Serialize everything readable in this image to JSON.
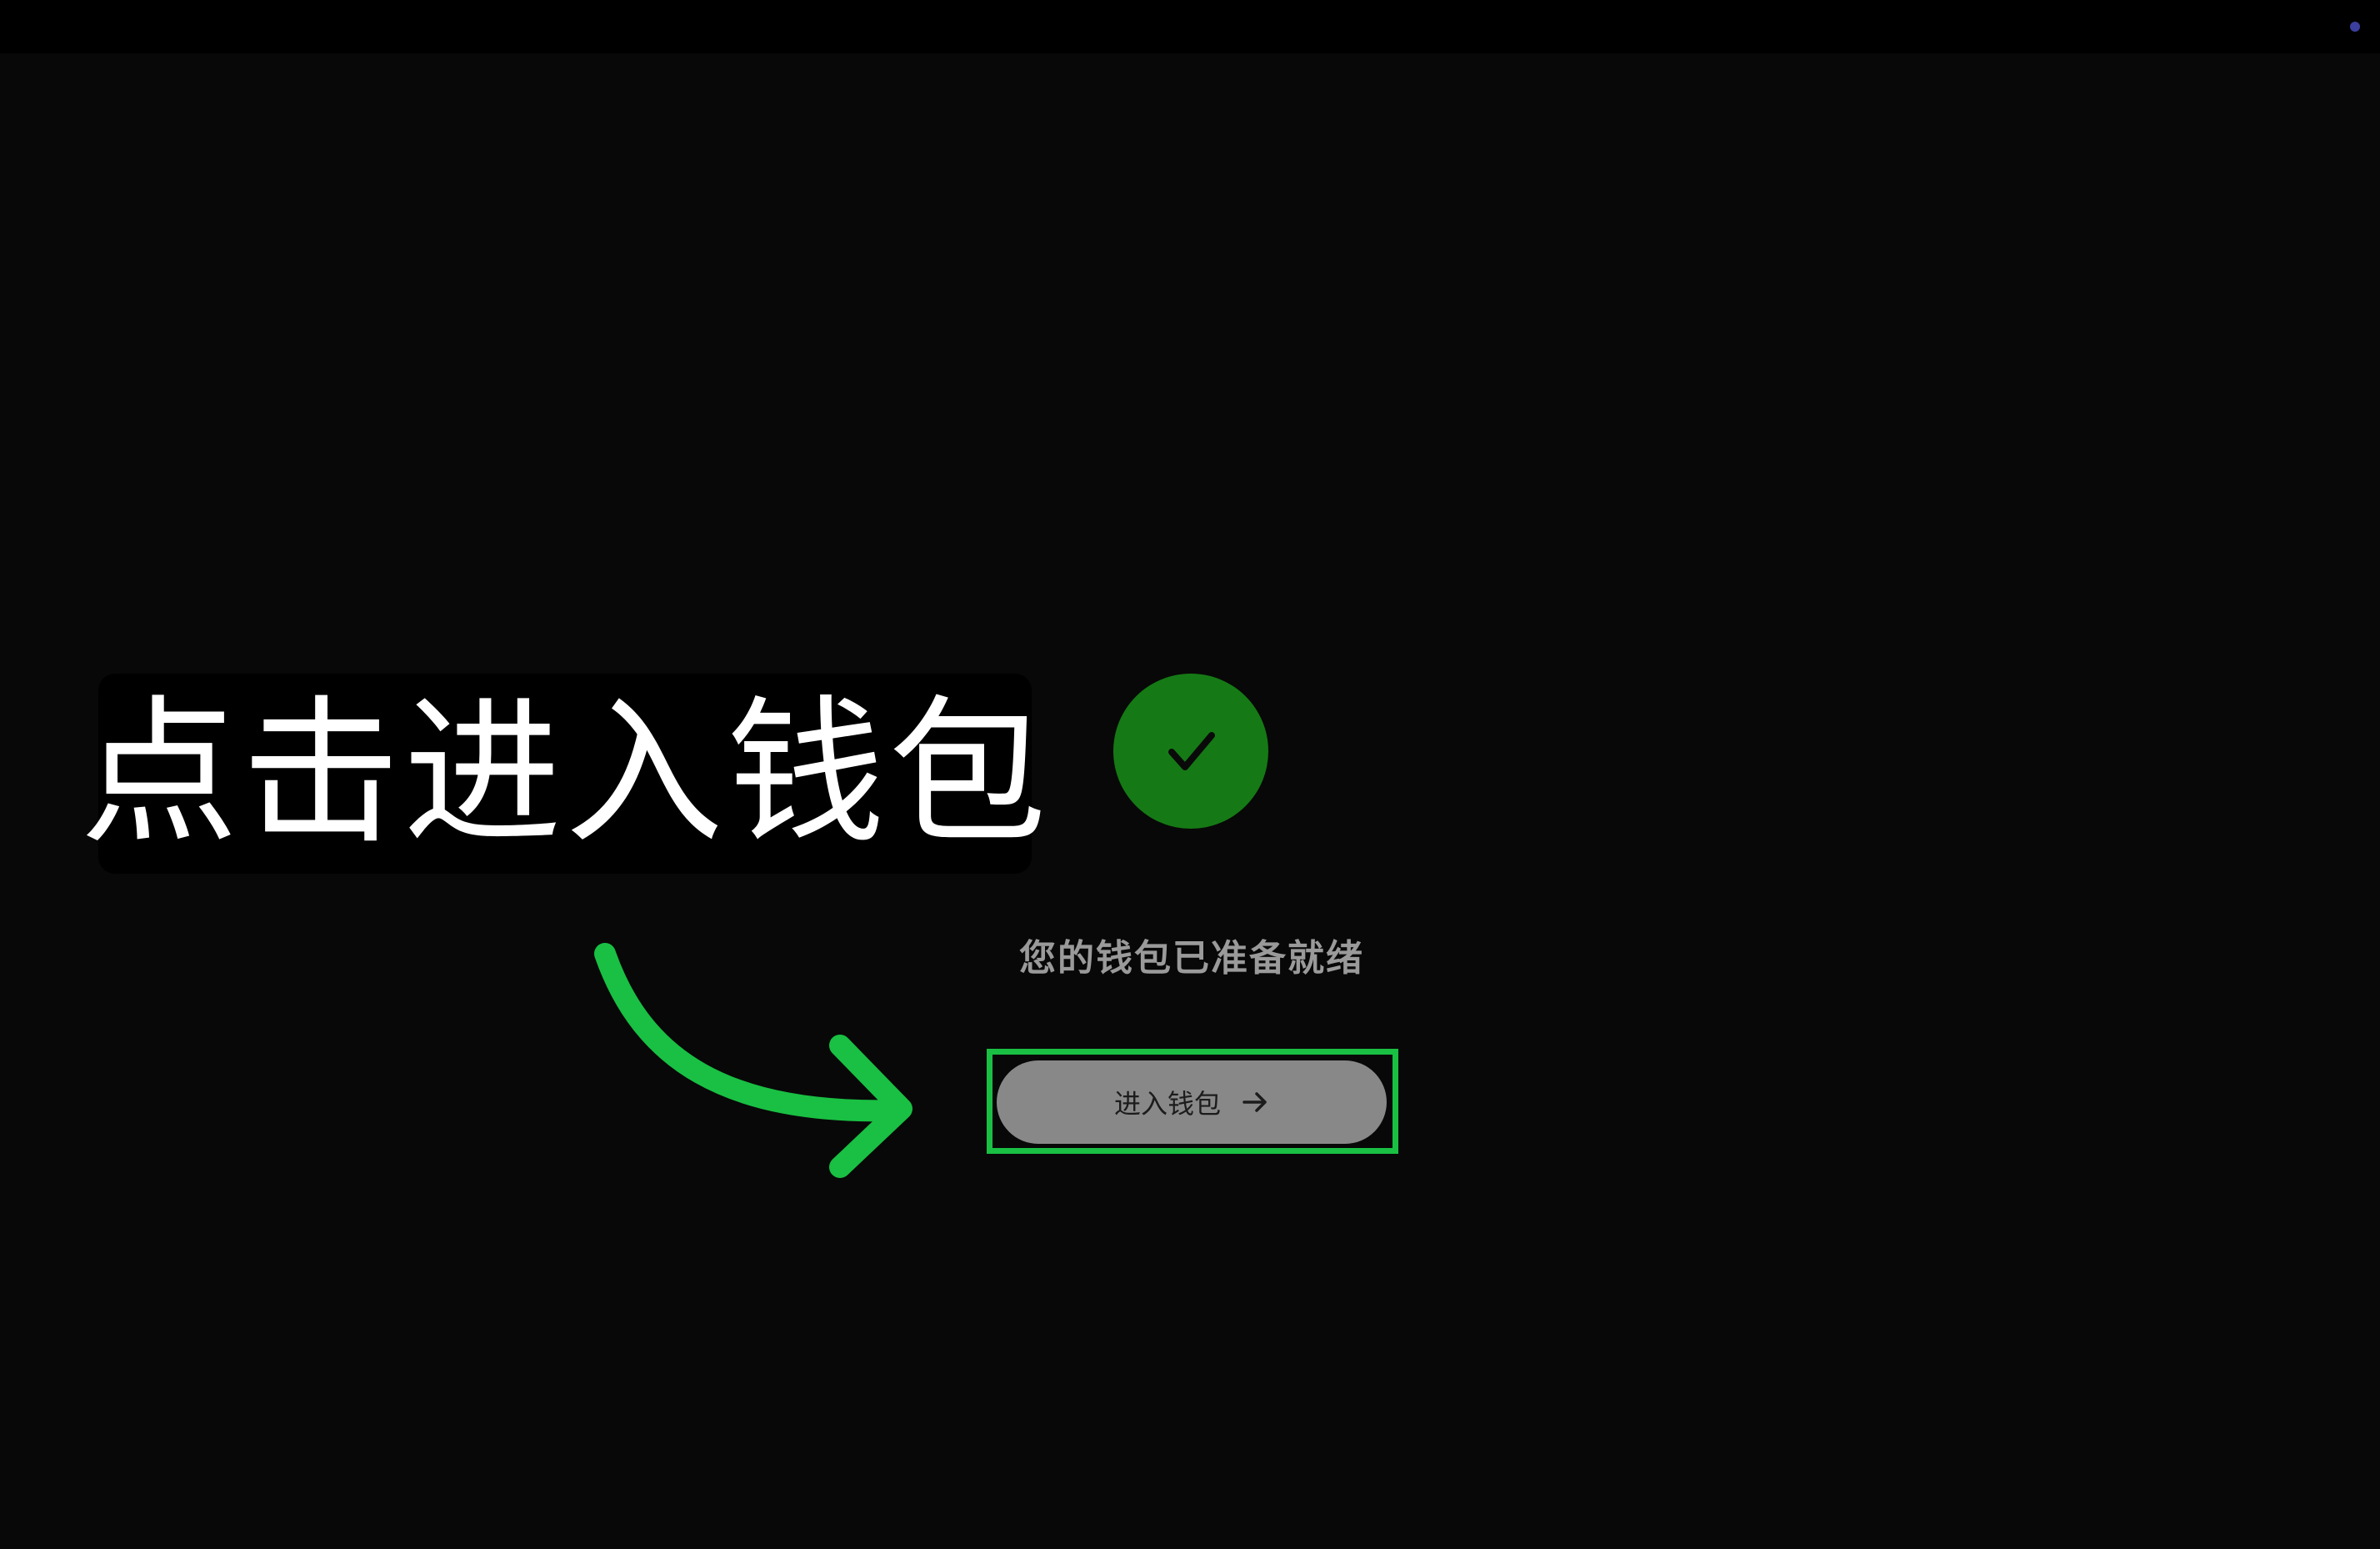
{
  "overlay": {
    "callout_text": "点击进入钱包"
  },
  "wallet_setup": {
    "status_icon": "checkmark-icon",
    "ready_message": "您的钱包已准备就绪",
    "enter_button_label": "进入钱包",
    "enter_button_icon": "arrow-right-icon"
  },
  "colors": {
    "background": "#080808",
    "success_green": "#157a15",
    "highlight_green": "#19c043",
    "button_gray": "#888888",
    "message_gray": "#9a9a9a"
  }
}
